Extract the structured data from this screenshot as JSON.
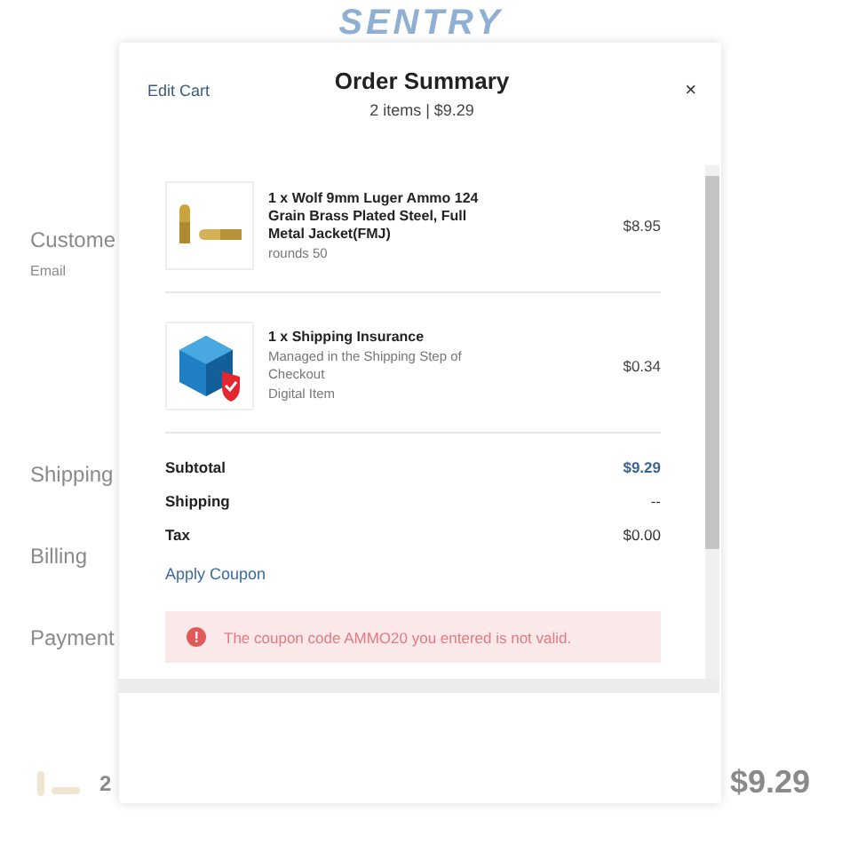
{
  "background": {
    "logo": "SENTRY",
    "sections": [
      {
        "label": "Custome",
        "kind": "heading"
      },
      {
        "label": "Email",
        "kind": "small"
      },
      {
        "label": "Shipping",
        "kind": "heading"
      },
      {
        "label": "Billing",
        "kind": "heading"
      },
      {
        "label": "Payment",
        "kind": "heading"
      }
    ],
    "cart_count": "2",
    "cart_total": "$9.29"
  },
  "modal": {
    "edit_link": "Edit Cart",
    "title": "Order Summary",
    "subtitle": "2 items | $9.29",
    "close": "×",
    "items": [
      {
        "kind": "ammo",
        "name": "1 x Wolf 9mm Luger Ammo 124 Grain Brass Plated Steel, Full Metal Jacket(FMJ)",
        "details": [
          "rounds 50"
        ],
        "price": "$8.95"
      },
      {
        "kind": "insurance",
        "name": "1 x Shipping Insurance",
        "details": [
          "Managed in the Shipping Step of Checkout",
          "Digital Item"
        ],
        "price": "$0.34"
      }
    ],
    "totals": [
      {
        "label": "Subtotal",
        "value": "$9.29",
        "highlight": true
      },
      {
        "label": "Shipping",
        "value": "--",
        "highlight": false
      },
      {
        "label": "Tax",
        "value": "$0.00",
        "highlight": false
      }
    ],
    "coupon_link": "Apply Coupon",
    "error": "The coupon code AMMO20 you entered is not valid."
  }
}
